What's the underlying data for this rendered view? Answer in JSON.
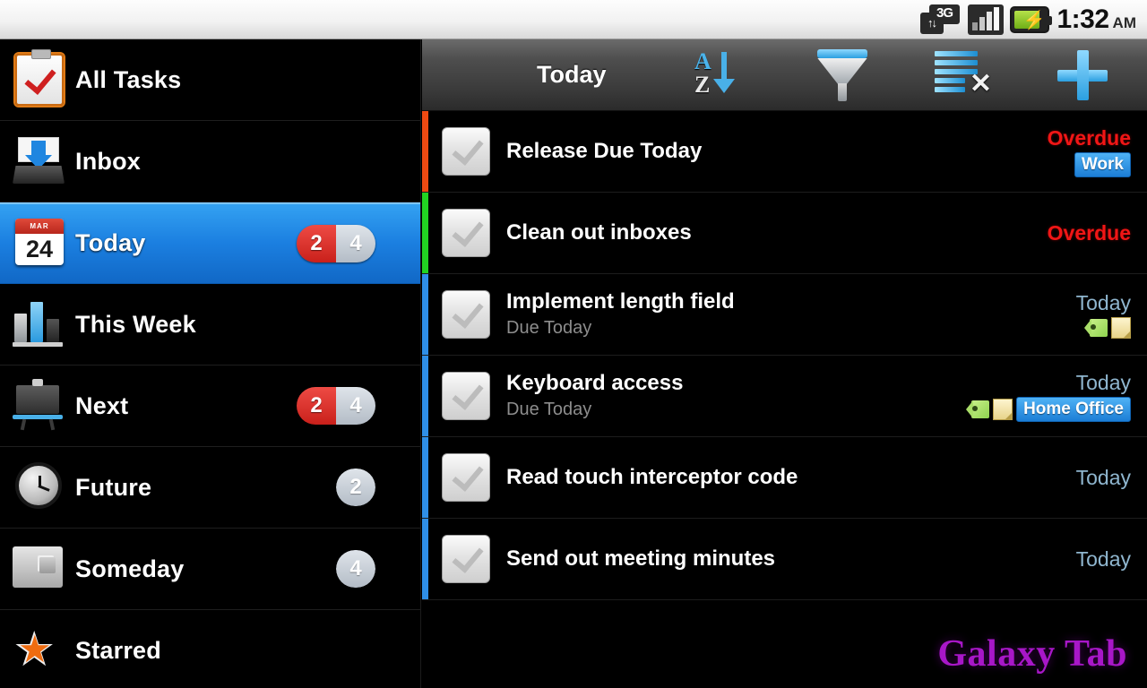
{
  "status_bar": {
    "network_icon": "3g-icon",
    "network_label": "3G",
    "signal_icon": "signal-bars-icon",
    "battery_icon": "battery-charging-icon",
    "time": "1:32",
    "meridiem": "AM"
  },
  "sidebar": {
    "items": [
      {
        "label": "All Tasks",
        "icon": "clipboard-icon",
        "badge_red": "",
        "badge_grey": "",
        "selected": false
      },
      {
        "label": "Inbox",
        "icon": "inbox-tray-icon",
        "badge_red": "",
        "badge_grey": "",
        "selected": false
      },
      {
        "label": "Today",
        "icon": "calendar-24-icon",
        "badge_red": "2",
        "badge_grey": "4",
        "selected": true
      },
      {
        "label": "This Week",
        "icon": "bar-chart-icon",
        "badge_red": "",
        "badge_grey": "",
        "selected": false
      },
      {
        "label": "Next",
        "icon": "easel-icon",
        "badge_red": "2",
        "badge_grey": "4",
        "selected": false
      },
      {
        "label": "Future",
        "icon": "clock-icon",
        "badge_red": "",
        "badge_grey": "2",
        "selected": false
      },
      {
        "label": "Someday",
        "icon": "archive-box-icon",
        "badge_red": "",
        "badge_grey": "4",
        "selected": false
      },
      {
        "label": "Starred",
        "icon": "star-icon",
        "badge_red": "",
        "badge_grey": "",
        "selected": false
      }
    ]
  },
  "toolbar": {
    "title": "Today",
    "sort_icon": "sort-az-descending-icon",
    "filter_icon": "filter-funnel-icon",
    "clear_icon": "clear-list-icon",
    "add_icon": "add-plus-icon"
  },
  "tasks": [
    {
      "title": "Release Due Today",
      "subtitle": "",
      "due": "Overdue",
      "due_state": "overdue",
      "bar_color": "#f04a12",
      "has_tag": false,
      "has_note": false,
      "context": "Work"
    },
    {
      "title": "Clean out inboxes",
      "subtitle": "",
      "due": "Overdue",
      "due_state": "overdue",
      "bar_color": "#22d422",
      "has_tag": false,
      "has_note": false,
      "context": ""
    },
    {
      "title": "Implement length field",
      "subtitle": "Due Today",
      "due": "Today",
      "due_state": "today",
      "bar_color": "#2f8fe8",
      "has_tag": true,
      "has_note": true,
      "context": ""
    },
    {
      "title": "Keyboard access",
      "subtitle": "Due Today",
      "due": "Today",
      "due_state": "today",
      "bar_color": "#2f8fe8",
      "has_tag": true,
      "has_note": true,
      "context": "Home Office"
    },
    {
      "title": "Read touch interceptor code",
      "subtitle": "",
      "due": "Today",
      "due_state": "today",
      "bar_color": "#2f8fe8",
      "has_tag": false,
      "has_note": false,
      "context": ""
    },
    {
      "title": "Send out meeting minutes",
      "subtitle": "",
      "due": "Today",
      "due_state": "today",
      "bar_color": "#2f8fe8",
      "has_tag": false,
      "has_note": false,
      "context": ""
    }
  ],
  "watermark": {
    "text": "Galaxy Tab",
    "color": "#a817c8"
  },
  "colors": {
    "accent_blue": "#1b7fe0",
    "overdue_red": "#f01616",
    "today_blue": "#8fb6cf",
    "badge_red": "#c9201b",
    "badge_grey": "#b3bcc6"
  }
}
